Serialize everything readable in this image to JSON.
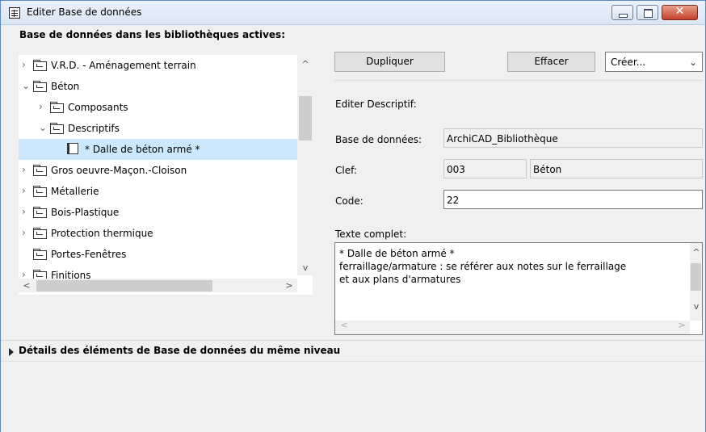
{
  "window": {
    "title": "Editer Base de données"
  },
  "left_pane": {
    "title": "Base de données dans les bibliothèques actives:",
    "tree": [
      {
        "label": "V.R.D. - Aménagement terrain",
        "level": 0,
        "expander": "collapsed",
        "icon": "folder-icon"
      },
      {
        "label": "Béton",
        "level": 0,
        "expander": "expanded",
        "icon": "folder-icon"
      },
      {
        "label": "Composants",
        "level": 1,
        "expander": "collapsed",
        "icon": "folder-grid-icon"
      },
      {
        "label": "Descriptifs",
        "level": 1,
        "expander": "expanded",
        "icon": "folder-book-icon"
      },
      {
        "label": "* Dalle de béton armé *",
        "level": 2,
        "expander": "none",
        "icon": "book-icon",
        "selected": true
      },
      {
        "label": "Gros oeuvre-Maçon.-Cloison",
        "level": 0,
        "expander": "collapsed",
        "icon": "folder-icon"
      },
      {
        "label": "Métallerie",
        "level": 0,
        "expander": "collapsed",
        "icon": "folder-icon"
      },
      {
        "label": "Bois-Plastique",
        "level": 0,
        "expander": "collapsed",
        "icon": "folder-icon"
      },
      {
        "label": "Protection thermique",
        "level": 0,
        "expander": "collapsed",
        "icon": "folder-icon"
      },
      {
        "label": "Portes-Fenêtres",
        "level": 0,
        "expander": "none",
        "icon": "folder-icon"
      },
      {
        "label": "Finitions",
        "level": 0,
        "expander": "collapsed",
        "icon": "folder-icon"
      }
    ]
  },
  "toolbar": {
    "duplicate_label": "Dupliquer",
    "delete_label": "Effacer",
    "create_value": "Créer..."
  },
  "editor": {
    "heading": "Editer Descriptif:",
    "database_label": "Base de données:",
    "database_value": "ArchiCAD_Bibliothèque",
    "key_label": "Clef:",
    "key_value": "003",
    "key_name": "Béton",
    "code_label": "Code:",
    "code_value": "22",
    "full_text_label": "Texte complet:",
    "full_text": "* Dalle de béton armé *\nferraillage/armature : se référer aux notes sur le ferraillage\net aux plans d'armatures"
  },
  "details": {
    "label": "Détails des éléments de Base de données du même niveau"
  },
  "colors": {
    "selection": "#cce8ff",
    "window_bg": "#f0f0f0",
    "close_button": "#c5412a"
  }
}
